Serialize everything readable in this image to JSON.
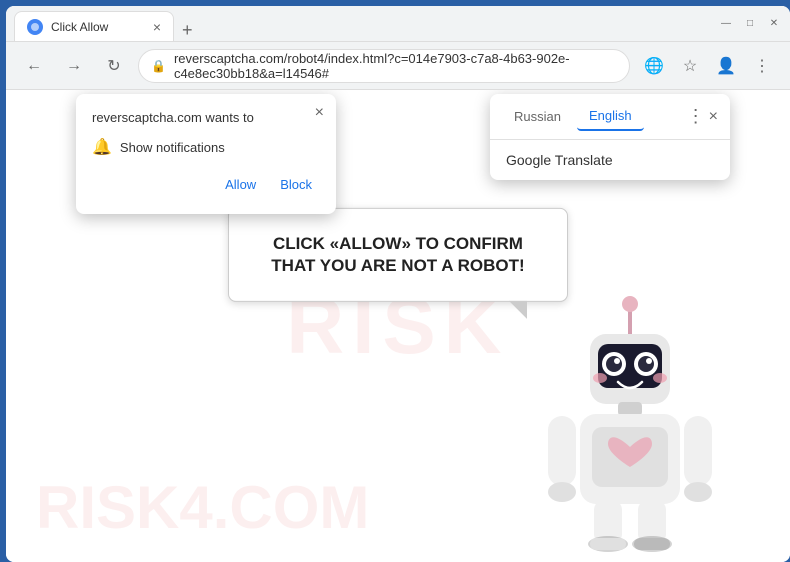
{
  "browser": {
    "tab_title": "Click Allow",
    "tab_close": "×",
    "new_tab": "+",
    "win_minimize": "—",
    "win_maximize": "□",
    "win_close": "✕",
    "back": "←",
    "forward": "→",
    "reload": "↻",
    "address": "reverscaptcha.com/robot4/index.html?c=014e7903-c7a8-4b63-902e-c4e8ec30bb18&a=l14546#",
    "bookmark": "☆",
    "profile": "👤",
    "more": "⋮",
    "translate_icon": "🌐"
  },
  "notification_popup": {
    "title": "reverscaptcha.com wants to",
    "close": "×",
    "bell": "🔔",
    "label": "Show notifications",
    "allow": "Allow",
    "block": "Block"
  },
  "translate_popup": {
    "tab_russian": "Russian",
    "tab_english": "English",
    "more": "⋮",
    "close": "×",
    "service": "Google Translate"
  },
  "page": {
    "message": "CLICK «ALLOW» TO CONFIRM THAT YOU ARE NOT A ROBOT!",
    "watermark": "RISK",
    "watermark2": "RISK4.COM"
  }
}
